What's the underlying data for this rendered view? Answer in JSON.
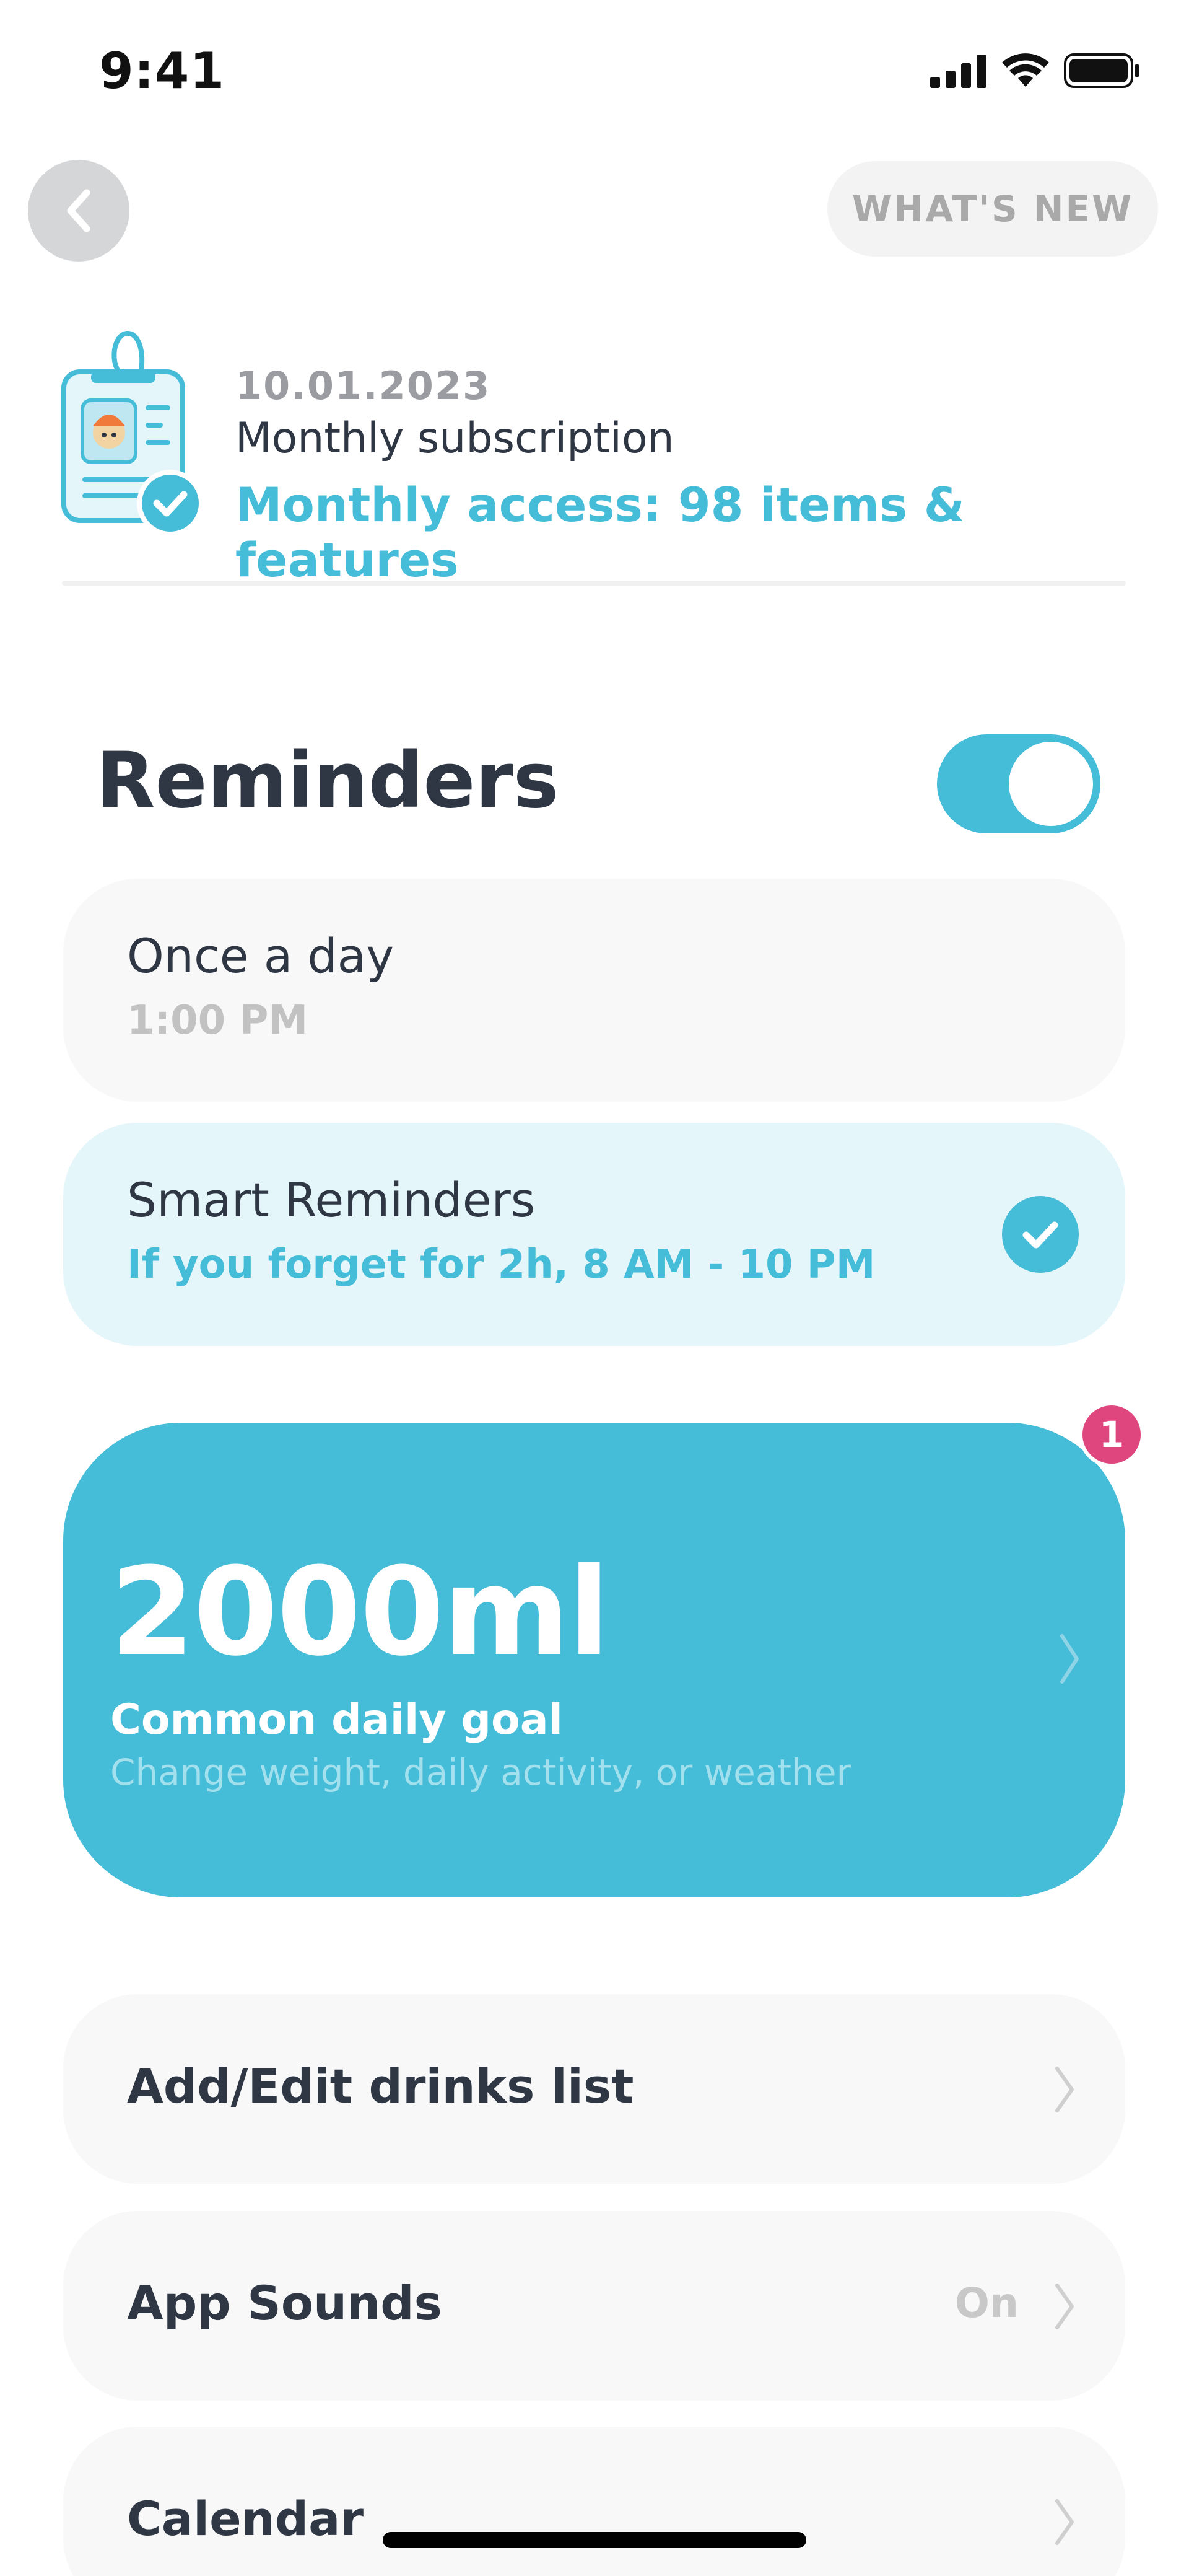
{
  "status_bar": {
    "time": "9:41"
  },
  "header": {
    "whats_new_label": "WHAT'S NEW"
  },
  "subscription": {
    "date": "10.01.2023",
    "title": "Monthly subscription",
    "access": "Monthly access: 98 items & features"
  },
  "reminders": {
    "title": "Reminders",
    "enabled": true,
    "options": [
      {
        "label": "Once a day",
        "sub": "1:00 PM",
        "selected": false
      },
      {
        "label": "Smart Reminders",
        "sub": "If you forget for 2h, 8 AM - 10 PM",
        "selected": true
      }
    ]
  },
  "goal": {
    "value": "2000ml",
    "label": "Common daily goal",
    "description": "Change weight, daily activity, or weather",
    "badge_count": "1"
  },
  "settings": [
    {
      "label": "Add/Edit drinks list",
      "value": ""
    },
    {
      "label": "App Sounds",
      "value": "On"
    },
    {
      "label": "Calendar",
      "value": ""
    }
  ],
  "colors": {
    "accent": "#45bcd8",
    "accent_light": "#e5f6fa",
    "badge": "#e0467e",
    "text_primary": "#2f3745",
    "card_bg": "#f8f8f8"
  },
  "icons": {
    "back": "chevron-left-icon",
    "subscription": "id-badge-icon",
    "check": "checkmark-icon",
    "chevron": "chevron-right-icon"
  }
}
